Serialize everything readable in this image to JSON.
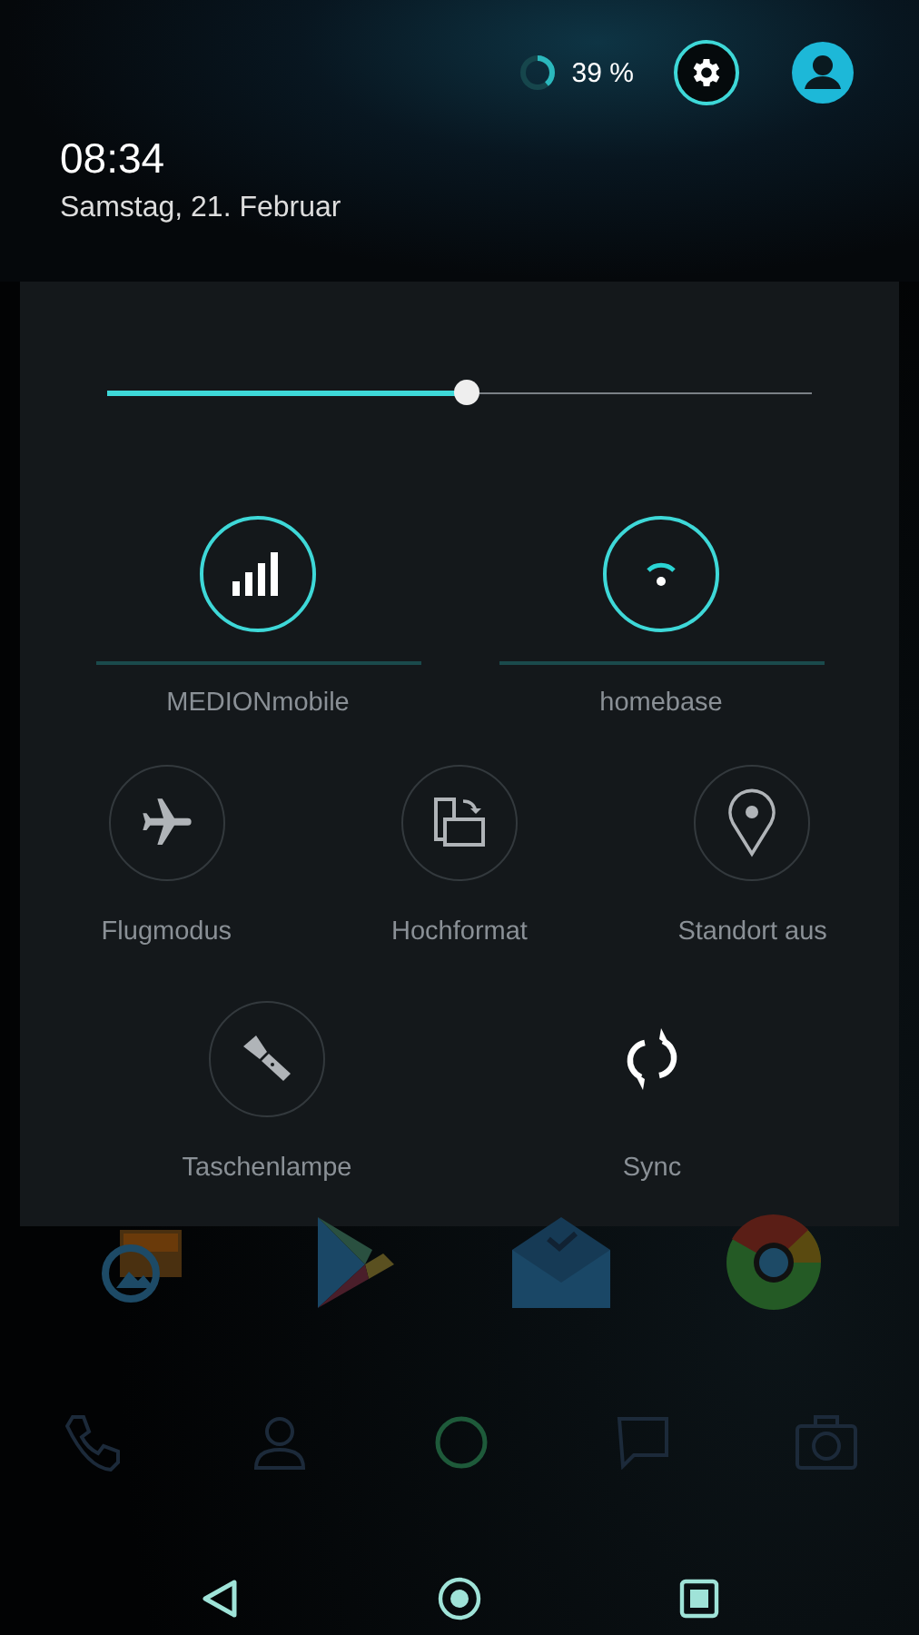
{
  "header": {
    "battery": {
      "reading": "39 %"
    },
    "time": "08:34",
    "date": "Samstag, 21. Februar"
  },
  "brightness": {
    "level": 0.51
  },
  "network": [
    {
      "kind": "signal",
      "label": "MEDIONmobile",
      "on": true
    },
    {
      "kind": "wifi",
      "label": "homebase",
      "on": true
    }
  ],
  "toggle_rows": [
    {
      "items": [
        {
          "kind": "airplane",
          "label": "Flugmodus",
          "on": false
        },
        {
          "kind": "rotation",
          "label": "Hochformat",
          "on": false
        },
        {
          "kind": "location",
          "label": "Standort aus",
          "on": false
        }
      ]
    },
    {
      "items": [
        {
          "kind": "flashlight",
          "label": "Taschenlampe",
          "on": false
        },
        {
          "kind": "sync",
          "label": "Sync",
          "on": true
        }
      ]
    }
  ]
}
